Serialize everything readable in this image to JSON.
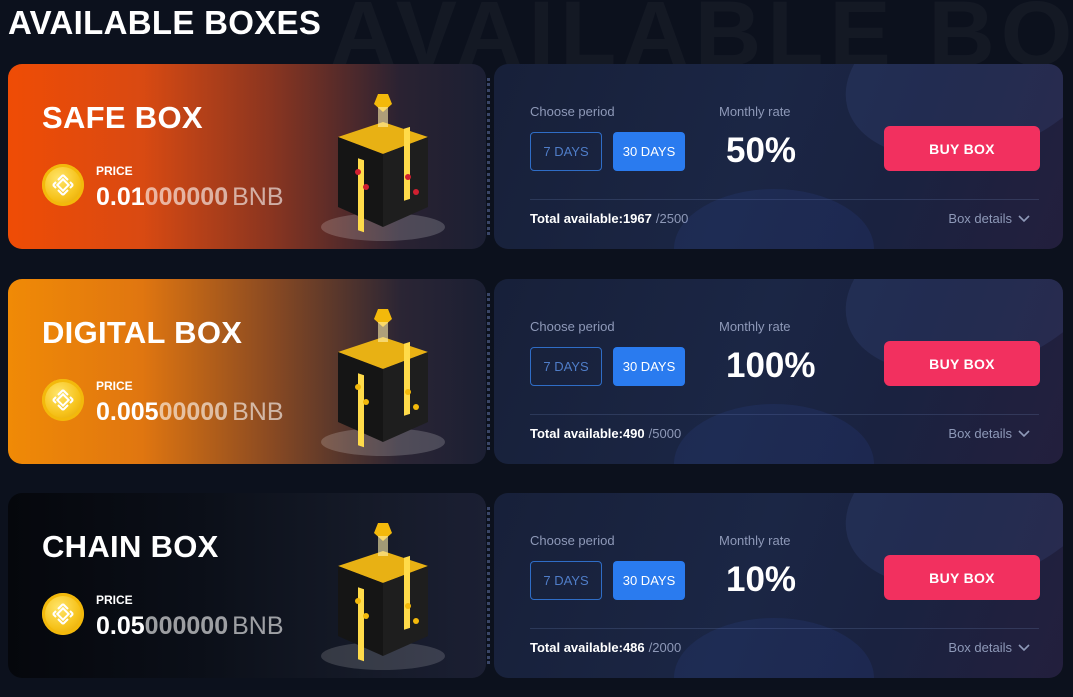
{
  "page": {
    "title": "AVAILABLE BOXES",
    "watermark": "AVAILABLE BOXES"
  },
  "colors": {
    "accent_blue": "#2a7bef",
    "buy_button": "#f2305f",
    "safe_box_gradient": "#ef4c05",
    "digital_box_gradient": "#f08a06",
    "chain_box_gradient": "#05070c",
    "coin_gold": "#f3b90b"
  },
  "boxes": [
    {
      "name": "SAFE BOX",
      "price_label": "PRICE",
      "price_main": "0.01",
      "price_trailing": "000000",
      "price_unit": "BNB",
      "choose_period_label": "Choose period",
      "period_7": "7 DAYS",
      "period_30": "30 DAYS",
      "selected_period": "30 DAYS",
      "monthly_rate_label": "Monthly rate",
      "monthly_rate": "50%",
      "buy_label": "BUY BOX",
      "total_label": "Total available:1967",
      "total_max": "/2500",
      "details_label": "Box details",
      "icon": "mystery-box-icon",
      "coin_icon": "bnb-coin-icon"
    },
    {
      "name": "DIGITAL BOX",
      "price_label": "PRICE",
      "price_main": "0.005",
      "price_trailing": "00000",
      "price_unit": "BNB",
      "choose_period_label": "Choose period",
      "period_7": "7 DAYS",
      "period_30": "30 DAYS",
      "selected_period": "30 DAYS",
      "monthly_rate_label": "Monthly rate",
      "monthly_rate": "100%",
      "buy_label": "BUY BOX",
      "total_label": "Total available:490",
      "total_max": "/5000",
      "details_label": "Box details",
      "icon": "mystery-box-icon",
      "coin_icon": "bnb-coin-icon"
    },
    {
      "name": "CHAIN BOX",
      "price_label": "PRICE",
      "price_main": "0.05",
      "price_trailing": "000000",
      "price_unit": "BNB",
      "choose_period_label": "Choose period",
      "period_7": "7 DAYS",
      "period_30": "30 DAYS",
      "selected_period": "30 DAYS",
      "monthly_rate_label": "Monthly rate",
      "monthly_rate": "10%",
      "buy_label": "BUY BOX",
      "total_label": "Total available:486",
      "total_max": "/2000",
      "details_label": "Box details",
      "icon": "mystery-box-icon",
      "coin_icon": "bnb-coin-icon"
    }
  ]
}
